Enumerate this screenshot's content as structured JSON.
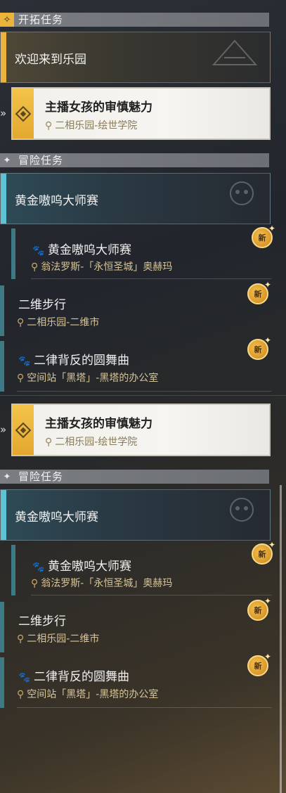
{
  "sections": {
    "main_title": "开拓任务",
    "adventure_title": "冒险任务"
  },
  "main_banner": "欢迎来到乐园",
  "selected": {
    "name": "主播女孩的审慎魅力",
    "location": "二相乐园-绘世学院"
  },
  "adventure_banner": "黄金嗷呜大师赛",
  "quests": [
    {
      "name": "黄金嗷呜大师赛",
      "location": "翁法罗斯-「永恒圣城」奥赫玛",
      "badge": "新"
    },
    {
      "name": "二维步行",
      "location": "二相乐园-二维市",
      "badge": "新"
    },
    {
      "name": "二律背反的圆舞曲",
      "location": "空间站「黑塔」-黑塔的办公室",
      "badge": "新"
    }
  ],
  "icons": {
    "main_section": "gold-diamond-icon",
    "adventure_section": "sparkle-icon",
    "location": "map-pin-icon",
    "quest_type": "paw-icon",
    "selected_indicator": "double-chevron-right-icon"
  },
  "colors": {
    "gold_accent": "#e9b33c",
    "blue_accent": "#5cc4d6",
    "badge": "#e0a032"
  }
}
